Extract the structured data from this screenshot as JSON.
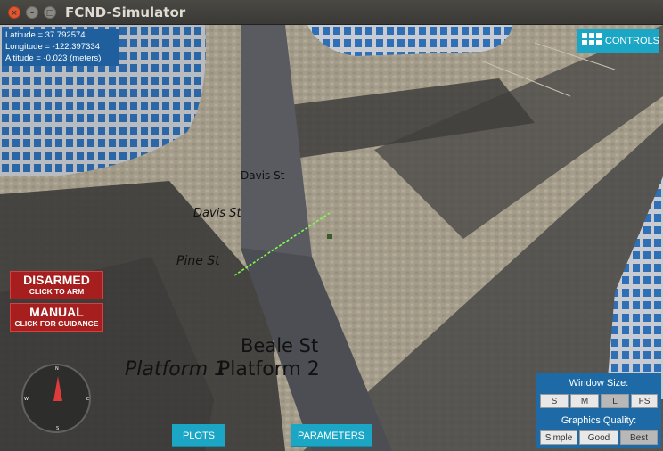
{
  "window": {
    "title": "FCND-Simulator",
    "close_glyph": "×",
    "min_glyph": "–",
    "max_glyph": "□"
  },
  "gps": {
    "latitude": "Latitude = 37.792574",
    "longitude": "Longitude = -122.397334",
    "altitude": "Altitude = -0.023 (meters)"
  },
  "controls": {
    "label": "CONTROLS"
  },
  "arm": {
    "state": "DISARMED",
    "hint": "CLICK TO ARM"
  },
  "mode": {
    "state": "MANUAL",
    "hint": "CLICK FOR GUIDANCE"
  },
  "compass": {
    "n": "N",
    "s": "S",
    "e": "E",
    "w": "W",
    "heading_color": "#e03a3a"
  },
  "street_labels": {
    "davis_1": "Davis St",
    "davis_2": "Davis St",
    "pine": "Pine St",
    "beale": "Beale St",
    "platform_1": "Platform 1",
    "platform_2": "Platform 2"
  },
  "buttons": {
    "plots": "PLOTS",
    "parameters": "PARAMETERS"
  },
  "settings": {
    "window_size_title": "Window Size:",
    "sizes": [
      "S",
      "M",
      "L",
      "FS"
    ],
    "selected_size": "L",
    "quality_title": "Graphics Quality:",
    "qualities": [
      "Simple",
      "Good",
      "Best"
    ],
    "selected_quality": "Best"
  },
  "colors": {
    "accent": "#1aa6c4",
    "panel": "#1d6aa6",
    "alert": "#a61e1e",
    "path": "#7dff4a"
  }
}
